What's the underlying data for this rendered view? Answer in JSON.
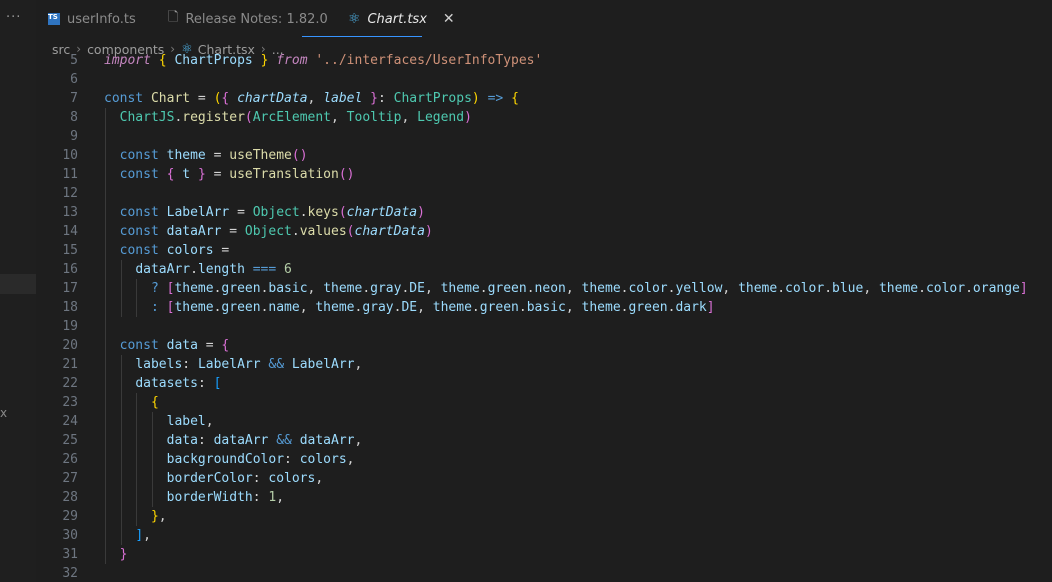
{
  "left_strip": {
    "more_label": "···",
    "x_label": "x"
  },
  "tabs": [
    {
      "label": "userInfo.ts",
      "icon": "typescript-icon",
      "icon_text": "TS"
    },
    {
      "label": "Release Notes: 1.82.0",
      "icon": "document-icon"
    },
    {
      "label": "Chart.tsx",
      "icon": "react-icon",
      "active": true,
      "close": "✕"
    }
  ],
  "breadcrumb": {
    "items": [
      "src",
      "components",
      "Chart.tsx",
      "..."
    ]
  },
  "colors": {
    "accent": "#3794ff",
    "background": "#1e1e1e"
  },
  "code_lines": [
    {
      "n": "5",
      "indent": 0,
      "tokens": [
        {
          "t": "import",
          "c": "k",
          "i": true
        },
        {
          "t": " "
        },
        {
          "t": "{",
          "c": "b1"
        },
        {
          "t": " "
        },
        {
          "t": "ChartProps",
          "c": "v"
        },
        {
          "t": " "
        },
        {
          "t": "}",
          "c": "b1"
        },
        {
          "t": " "
        },
        {
          "t": "from",
          "c": "k",
          "i": true
        },
        {
          "t": " "
        },
        {
          "t": "'../interfaces/UserInfoTypes'",
          "c": "s"
        }
      ]
    },
    {
      "n": "6",
      "indent": 0,
      "tokens": []
    },
    {
      "n": "7",
      "indent": 0,
      "tokens": [
        {
          "t": "const",
          "c": "kb"
        },
        {
          "t": " "
        },
        {
          "t": "Chart",
          "c": "f"
        },
        {
          "t": " = "
        },
        {
          "t": "(",
          "c": "b1"
        },
        {
          "t": "{",
          "c": "b2"
        },
        {
          "t": " "
        },
        {
          "t": "chartData",
          "c": "p"
        },
        {
          "t": ", "
        },
        {
          "t": "label",
          "c": "p"
        },
        {
          "t": " "
        },
        {
          "t": "}",
          "c": "b2"
        },
        {
          "t": ": "
        },
        {
          "t": "ChartProps",
          "c": "t"
        },
        {
          "t": ")",
          "c": "b1"
        },
        {
          "t": " "
        },
        {
          "t": "=>",
          "c": "kb"
        },
        {
          "t": " "
        },
        {
          "t": "{",
          "c": "b1"
        }
      ]
    },
    {
      "n": "8",
      "indent": 1,
      "tokens": [
        {
          "t": "ChartJS",
          "c": "t"
        },
        {
          "t": "."
        },
        {
          "t": "register",
          "c": "f"
        },
        {
          "t": "(",
          "c": "b2"
        },
        {
          "t": "ArcElement",
          "c": "t"
        },
        {
          "t": ", "
        },
        {
          "t": "Tooltip",
          "c": "t"
        },
        {
          "t": ", "
        },
        {
          "t": "Legend",
          "c": "t"
        },
        {
          "t": ")",
          "c": "b2"
        }
      ]
    },
    {
      "n": "9",
      "indent": 1,
      "tokens": []
    },
    {
      "n": "10",
      "indent": 1,
      "tokens": [
        {
          "t": "const",
          "c": "kb"
        },
        {
          "t": " "
        },
        {
          "t": "theme",
          "c": "v"
        },
        {
          "t": " = "
        },
        {
          "t": "useTheme",
          "c": "f"
        },
        {
          "t": "()",
          "c": "b2"
        }
      ]
    },
    {
      "n": "11",
      "indent": 1,
      "tokens": [
        {
          "t": "const",
          "c": "kb"
        },
        {
          "t": " "
        },
        {
          "t": "{",
          "c": "b2"
        },
        {
          "t": " "
        },
        {
          "t": "t",
          "c": "v"
        },
        {
          "t": " "
        },
        {
          "t": "}",
          "c": "b2"
        },
        {
          "t": " = "
        },
        {
          "t": "useTranslation",
          "c": "f"
        },
        {
          "t": "()",
          "c": "b2"
        }
      ]
    },
    {
      "n": "12",
      "indent": 1,
      "tokens": []
    },
    {
      "n": "13",
      "indent": 1,
      "tokens": [
        {
          "t": "const",
          "c": "kb"
        },
        {
          "t": " "
        },
        {
          "t": "LabelArr",
          "c": "v"
        },
        {
          "t": " = "
        },
        {
          "t": "Object",
          "c": "t"
        },
        {
          "t": "."
        },
        {
          "t": "keys",
          "c": "f"
        },
        {
          "t": "(",
          "c": "b2"
        },
        {
          "t": "chartData",
          "c": "p"
        },
        {
          "t": ")",
          "c": "b2"
        }
      ]
    },
    {
      "n": "14",
      "indent": 1,
      "tokens": [
        {
          "t": "const",
          "c": "kb"
        },
        {
          "t": " "
        },
        {
          "t": "dataArr",
          "c": "v"
        },
        {
          "t": " = "
        },
        {
          "t": "Object",
          "c": "t"
        },
        {
          "t": "."
        },
        {
          "t": "values",
          "c": "f"
        },
        {
          "t": "(",
          "c": "b2"
        },
        {
          "t": "chartData",
          "c": "p"
        },
        {
          "t": ")",
          "c": "b2"
        }
      ]
    },
    {
      "n": "15",
      "indent": 1,
      "tokens": [
        {
          "t": "const",
          "c": "kb"
        },
        {
          "t": " "
        },
        {
          "t": "colors",
          "c": "v"
        },
        {
          "t": " ="
        }
      ]
    },
    {
      "n": "16",
      "indent": 2,
      "tokens": [
        {
          "t": "dataArr",
          "c": "v"
        },
        {
          "t": "."
        },
        {
          "t": "length",
          "c": "v"
        },
        {
          "t": " "
        },
        {
          "t": "===",
          "c": "kb"
        },
        {
          "t": " "
        },
        {
          "t": "6",
          "c": "n"
        }
      ]
    },
    {
      "n": "17",
      "indent": 3,
      "tokens": [
        {
          "t": "?",
          "c": "kb"
        },
        {
          "t": " "
        },
        {
          "t": "[",
          "c": "b2"
        },
        {
          "t": "theme",
          "c": "v"
        },
        {
          "t": "."
        },
        {
          "t": "green",
          "c": "v"
        },
        {
          "t": "."
        },
        {
          "t": "basic",
          "c": "v"
        },
        {
          "t": ", "
        },
        {
          "t": "theme",
          "c": "v"
        },
        {
          "t": "."
        },
        {
          "t": "gray",
          "c": "v"
        },
        {
          "t": "."
        },
        {
          "t": "DE",
          "c": "v"
        },
        {
          "t": ", "
        },
        {
          "t": "theme",
          "c": "v"
        },
        {
          "t": "."
        },
        {
          "t": "green",
          "c": "v"
        },
        {
          "t": "."
        },
        {
          "t": "neon",
          "c": "v"
        },
        {
          "t": ", "
        },
        {
          "t": "theme",
          "c": "v"
        },
        {
          "t": "."
        },
        {
          "t": "color",
          "c": "v"
        },
        {
          "t": "."
        },
        {
          "t": "yellow",
          "c": "v"
        },
        {
          "t": ", "
        },
        {
          "t": "theme",
          "c": "v"
        },
        {
          "t": "."
        },
        {
          "t": "color",
          "c": "v"
        },
        {
          "t": "."
        },
        {
          "t": "blue",
          "c": "v"
        },
        {
          "t": ", "
        },
        {
          "t": "theme",
          "c": "v"
        },
        {
          "t": "."
        },
        {
          "t": "color",
          "c": "v"
        },
        {
          "t": "."
        },
        {
          "t": "orange",
          "c": "v"
        },
        {
          "t": "]",
          "c": "b2"
        }
      ]
    },
    {
      "n": "18",
      "indent": 3,
      "tokens": [
        {
          "t": ":",
          "c": "kb"
        },
        {
          "t": " "
        },
        {
          "t": "[",
          "c": "b2"
        },
        {
          "t": "theme",
          "c": "v"
        },
        {
          "t": "."
        },
        {
          "t": "green",
          "c": "v"
        },
        {
          "t": "."
        },
        {
          "t": "name",
          "c": "v"
        },
        {
          "t": ", "
        },
        {
          "t": "theme",
          "c": "v"
        },
        {
          "t": "."
        },
        {
          "t": "gray",
          "c": "v"
        },
        {
          "t": "."
        },
        {
          "t": "DE",
          "c": "v"
        },
        {
          "t": ", "
        },
        {
          "t": "theme",
          "c": "v"
        },
        {
          "t": "."
        },
        {
          "t": "green",
          "c": "v"
        },
        {
          "t": "."
        },
        {
          "t": "basic",
          "c": "v"
        },
        {
          "t": ", "
        },
        {
          "t": "theme",
          "c": "v"
        },
        {
          "t": "."
        },
        {
          "t": "green",
          "c": "v"
        },
        {
          "t": "."
        },
        {
          "t": "dark",
          "c": "v"
        },
        {
          "t": "]",
          "c": "b2"
        }
      ]
    },
    {
      "n": "19",
      "indent": 1,
      "tokens": []
    },
    {
      "n": "20",
      "indent": 1,
      "tokens": [
        {
          "t": "const",
          "c": "kb"
        },
        {
          "t": " "
        },
        {
          "t": "data",
          "c": "v"
        },
        {
          "t": " = "
        },
        {
          "t": "{",
          "c": "b2"
        }
      ]
    },
    {
      "n": "21",
      "indent": 2,
      "tokens": [
        {
          "t": "labels",
          "c": "v"
        },
        {
          "t": ": "
        },
        {
          "t": "LabelArr",
          "c": "v"
        },
        {
          "t": " "
        },
        {
          "t": "&&",
          "c": "kb"
        },
        {
          "t": " "
        },
        {
          "t": "LabelArr",
          "c": "v"
        },
        {
          "t": ","
        }
      ]
    },
    {
      "n": "22",
      "indent": 2,
      "tokens": [
        {
          "t": "datasets",
          "c": "v"
        },
        {
          "t": ": "
        },
        {
          "t": "[",
          "c": "b3"
        }
      ]
    },
    {
      "n": "23",
      "indent": 3,
      "tokens": [
        {
          "t": "{",
          "c": "b1"
        }
      ]
    },
    {
      "n": "24",
      "indent": 4,
      "tokens": [
        {
          "t": "label",
          "c": "v"
        },
        {
          "t": ","
        }
      ]
    },
    {
      "n": "25",
      "indent": 4,
      "tokens": [
        {
          "t": "data",
          "c": "v"
        },
        {
          "t": ": "
        },
        {
          "t": "dataArr",
          "c": "v"
        },
        {
          "t": " "
        },
        {
          "t": "&&",
          "c": "kb"
        },
        {
          "t": " "
        },
        {
          "t": "dataArr",
          "c": "v"
        },
        {
          "t": ","
        }
      ]
    },
    {
      "n": "26",
      "indent": 4,
      "tokens": [
        {
          "t": "backgroundColor",
          "c": "v"
        },
        {
          "t": ": "
        },
        {
          "t": "colors",
          "c": "v"
        },
        {
          "t": ","
        }
      ]
    },
    {
      "n": "27",
      "indent": 4,
      "tokens": [
        {
          "t": "borderColor",
          "c": "v"
        },
        {
          "t": ": "
        },
        {
          "t": "colors",
          "c": "v"
        },
        {
          "t": ","
        }
      ]
    },
    {
      "n": "28",
      "indent": 4,
      "tokens": [
        {
          "t": "borderWidth",
          "c": "v"
        },
        {
          "t": ": "
        },
        {
          "t": "1",
          "c": "n"
        },
        {
          "t": ","
        }
      ]
    },
    {
      "n": "29",
      "indent": 3,
      "tokens": [
        {
          "t": "}",
          "c": "b1"
        },
        {
          "t": ","
        }
      ]
    },
    {
      "n": "30",
      "indent": 2,
      "tokens": [
        {
          "t": "]",
          "c": "b3"
        },
        {
          "t": ","
        }
      ]
    },
    {
      "n": "31",
      "indent": 1,
      "tokens": [
        {
          "t": "}",
          "c": "b2"
        }
      ]
    },
    {
      "n": "32",
      "indent": 0,
      "tokens": []
    }
  ]
}
